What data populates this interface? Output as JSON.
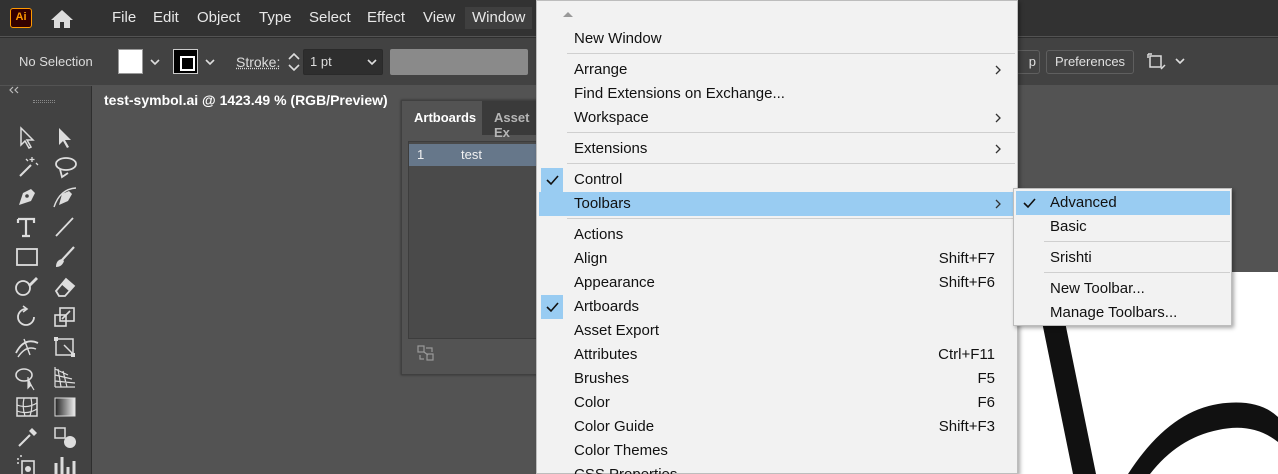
{
  "app": {
    "logo_text": "Ai"
  },
  "menubar": {
    "items": [
      "File",
      "Edit",
      "Object",
      "Type",
      "Select",
      "Effect",
      "View",
      "Window"
    ],
    "active": "Window"
  },
  "controlbar": {
    "selection_label": "No Selection",
    "stroke_label": "Stroke:",
    "stroke_value": "1 pt",
    "partial_button_label": "p",
    "preferences_label": "Preferences"
  },
  "document": {
    "tab_title": "test-symbol.ai @ 1423.49 % (RGB/Preview)"
  },
  "artboards_panel": {
    "tabs": [
      "Artboards",
      "Asset Ex"
    ],
    "rows": [
      {
        "number": "1",
        "name": "test"
      }
    ]
  },
  "window_menu": {
    "items": [
      {
        "label": "New Window"
      },
      {
        "label": "Arrange",
        "submenu": true
      },
      {
        "label": "Find Extensions on Exchange..."
      },
      {
        "label": "Workspace",
        "submenu": true
      },
      {
        "label": "Extensions",
        "submenu": true
      },
      {
        "label": "Control",
        "checked": true
      },
      {
        "label": "Toolbars",
        "submenu": true,
        "highlighted": true
      },
      {
        "label": "Actions"
      },
      {
        "label": "Align",
        "shortcut": "Shift+F7"
      },
      {
        "label": "Appearance",
        "shortcut": "Shift+F6"
      },
      {
        "label": "Artboards",
        "checked": true
      },
      {
        "label": "Asset Export"
      },
      {
        "label": "Attributes",
        "shortcut": "Ctrl+F11"
      },
      {
        "label": "Brushes",
        "shortcut": "F5"
      },
      {
        "label": "Color",
        "shortcut": "F6"
      },
      {
        "label": "Color Guide",
        "shortcut": "Shift+F3"
      },
      {
        "label": "Color Themes"
      },
      {
        "label": "CSS Properties"
      }
    ]
  },
  "toolbars_submenu": {
    "items": [
      {
        "label": "Advanced",
        "checked": true,
        "highlighted": true
      },
      {
        "label": "Basic"
      },
      {
        "label": "Srishti"
      },
      {
        "label": "New Toolbar..."
      },
      {
        "label": "Manage Toolbars..."
      }
    ]
  },
  "colors": {
    "menu_highlight": "#99ccf2",
    "menubar_bg": "#323232",
    "panel_bg": "#424242",
    "canvas_bg": "#535353",
    "logo_accent": "#ff9a00"
  },
  "icons": {
    "tools": [
      "selection-tool-icon",
      "direct-selection-tool-icon",
      "magic-wand-tool-icon",
      "lasso-tool-icon",
      "pen-tool-icon",
      "curvature-tool-icon",
      "type-tool-icon",
      "line-segment-tool-icon",
      "rectangle-tool-icon",
      "paintbrush-tool-icon",
      "shaper-tool-icon",
      "eraser-tool-icon",
      "rotate-tool-icon",
      "scale-tool-icon",
      "width-tool-icon",
      "free-transform-tool-icon",
      "shape-builder-tool-icon",
      "perspective-grid-tool-icon",
      "mesh-tool-icon",
      "gradient-tool-icon",
      "eyedropper-tool-icon",
      "blend-tool-icon",
      "symbol-sprayer-tool-icon",
      "column-graph-tool-icon"
    ]
  }
}
